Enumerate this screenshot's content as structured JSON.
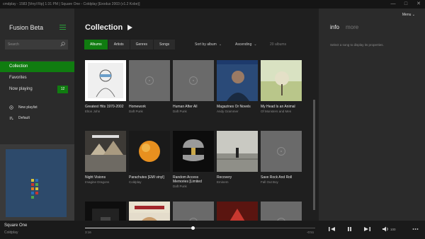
{
  "window": {
    "title": "cmdplay - 1583 [Vinyl Rip] 1:31 PM | Square One - Coldplay [Exodus 2003 (v1.2 Kobe)]"
  },
  "sidebar": {
    "app_title": "Fusion Beta",
    "search_placeholder": "Search",
    "nav": [
      {
        "label": "Collection"
      },
      {
        "label": "Favorites"
      },
      {
        "label": "Now playing",
        "badge": "12"
      }
    ],
    "playlists": [
      {
        "label": "New playlist",
        "icon": "plus-circle-icon"
      },
      {
        "label": "Default",
        "icon": "playlist-icon"
      }
    ]
  },
  "content": {
    "title": "Collection",
    "filters": [
      "Albums",
      "Artists",
      "Genres",
      "Songs"
    ],
    "sort_by": "Sort by album",
    "order": "Ascending",
    "count": "20 albums",
    "albums": [
      {
        "title": "Greatest Hits 1970-2002",
        "artist": "Elton John",
        "art": "elton"
      },
      {
        "title": "Homework",
        "artist": "Daft Punk",
        "art": "placeholder"
      },
      {
        "title": "Human After All",
        "artist": "Daft Punk",
        "art": "placeholder"
      },
      {
        "title": "Magazines Or Novels",
        "artist": "Andy Grammer",
        "art": "andy"
      },
      {
        "title": "My Head Is an Animal",
        "artist": "Of Monsters and Men",
        "art": "monsters"
      },
      {
        "title": "Night Visions",
        "artist": "Imagine Dragons",
        "art": "imagine"
      },
      {
        "title": "Parachutes [EMI vinyl]",
        "artist": "Coldplay",
        "art": "parachutes"
      },
      {
        "title": "Random Access Memories [Limited",
        "artist": "Daft Punk",
        "art": "ram"
      },
      {
        "title": "Recovery",
        "artist": "Eminem",
        "art": "recovery"
      },
      {
        "title": "Save Rock And Roll",
        "artist": "Fall Out Boy",
        "art": "placeholder"
      },
      {
        "title": "",
        "artist": "",
        "art": "dark"
      },
      {
        "title": "",
        "artist": "",
        "art": "beethoven"
      },
      {
        "title": "",
        "artist": "",
        "art": "placeholder"
      },
      {
        "title": "",
        "artist": "",
        "art": "red"
      },
      {
        "title": "",
        "artist": "",
        "art": "placeholder"
      },
      {
        "title": "",
        "artist": "",
        "art": "blue"
      }
    ]
  },
  "info": {
    "menu": "Menu",
    "tab_info": "info",
    "tab_more": "more",
    "hint": "Select a song to display its properties."
  },
  "player": {
    "title": "Square One",
    "artist": "Coldplay",
    "elapsed": "3:16",
    "remaining": "-0:51",
    "progress": 0.47,
    "volume": "100"
  },
  "colors": {
    "accent": "#107c10",
    "bg": "#1f1f1f",
    "panel": "#2b2b2b"
  }
}
